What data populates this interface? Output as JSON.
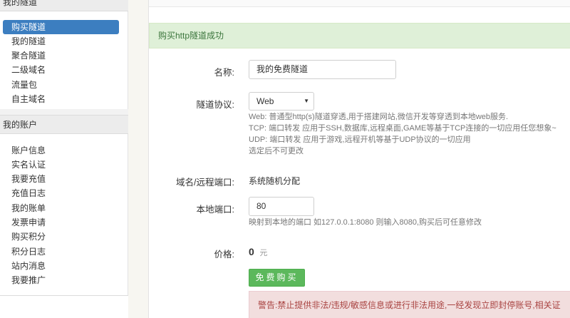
{
  "sidebar": {
    "section_tunnels": "我的隧道",
    "tunnel_items": [
      {
        "label": "购买隧道",
        "active": true
      },
      {
        "label": "我的隧道"
      },
      {
        "label": "聚合隧道"
      },
      {
        "label": "二级域名"
      },
      {
        "label": "流量包"
      },
      {
        "label": "自主域名"
      }
    ],
    "section_account": "我的账户",
    "account_items": [
      {
        "label": "账户信息"
      },
      {
        "label": "实名认证"
      },
      {
        "label": "我要充值"
      },
      {
        "label": "充值日志"
      },
      {
        "label": "我的账单"
      },
      {
        "label": "发票申请"
      },
      {
        "label": "购买积分"
      },
      {
        "label": "积分日志"
      },
      {
        "label": "站内消息"
      },
      {
        "label": "我要推广"
      }
    ]
  },
  "form": {
    "success_message": "购买http隧道成功",
    "name_label": "名称:",
    "name_value": "我的免费隧道",
    "protocol_label": "隧道协议:",
    "protocol_value": "Web",
    "protocol_help": [
      "Web: 普通型http(s)隧道穿透,用于搭建网站,微信开发等穿透到本地web服务.",
      "TCP: 端口转发 应用于SSH,数据库,远程桌面,GAME等基于TCP连接的一切应用任您想象~",
      "UDP: 端口转发 应用于游戏,远程开机等基于UDP协议的一切应用",
      "选定后不可更改"
    ],
    "domain_label": "域名/远程端口:",
    "domain_value": "系统随机分配",
    "port_label": "本地端口:",
    "port_value": "80",
    "port_help": "映射到本地的端口 如127.0.0.1:8080 则输入8080,购买后可任意修改",
    "price_label": "价格:",
    "price_value": "0",
    "price_unit": "元",
    "buy_button": "免费购买",
    "warning": "警告:禁止提供非法/违规/敏感信息或进行非法用途,一经发现立即封停账号,相关证"
  },
  "colors": {
    "active_nav": "#3c7ec0",
    "success_bg": "#dff0d8",
    "buy_button": "#5cb85c",
    "danger_bg": "#f2dede"
  }
}
